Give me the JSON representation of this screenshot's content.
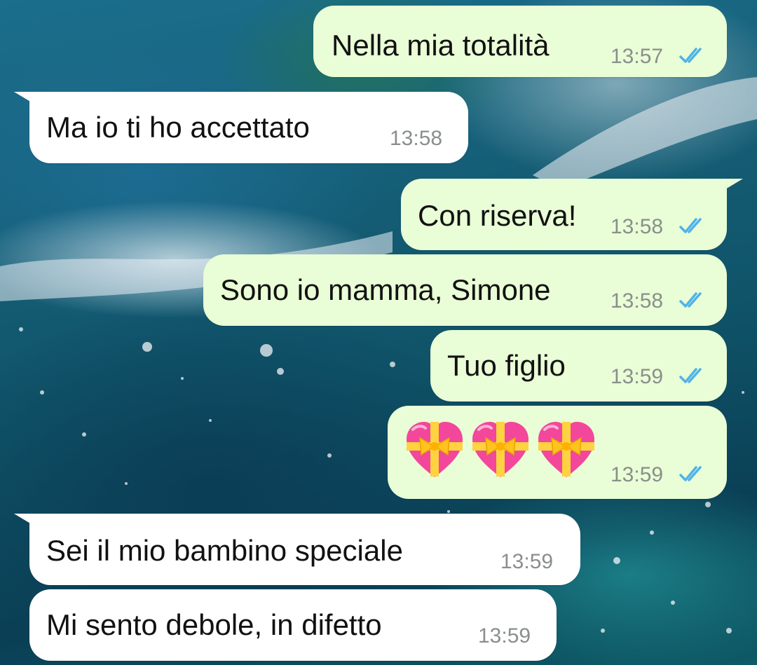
{
  "colors": {
    "outgoing_bubble": "#e9fdd6",
    "incoming_bubble": "#ffffff",
    "timestamp": "#8a8f8b",
    "read_ticks": "#4fb3e8"
  },
  "messages": [
    {
      "direction": "outgoing",
      "text": "Nella mia totalità",
      "time": "13:57",
      "status": "read"
    },
    {
      "direction": "incoming",
      "text": "Ma io ti ho accettato",
      "time": "13:58"
    },
    {
      "direction": "outgoing",
      "text": "Con riserva!",
      "time": "13:58",
      "status": "read"
    },
    {
      "direction": "outgoing",
      "text": "Sono io mamma, Simone",
      "time": "13:58",
      "status": "read"
    },
    {
      "direction": "outgoing",
      "text": "Tuo figlio",
      "time": "13:59",
      "status": "read"
    },
    {
      "direction": "outgoing",
      "emoji": [
        "heart-with-ribbon",
        "heart-with-ribbon",
        "heart-with-ribbon"
      ],
      "time": "13:59",
      "status": "read"
    },
    {
      "direction": "incoming",
      "text": "Sei il mio bambino speciale",
      "time": "13:59"
    },
    {
      "direction": "incoming",
      "text": "Mi sento debole, in difetto",
      "time": "13:59"
    }
  ]
}
